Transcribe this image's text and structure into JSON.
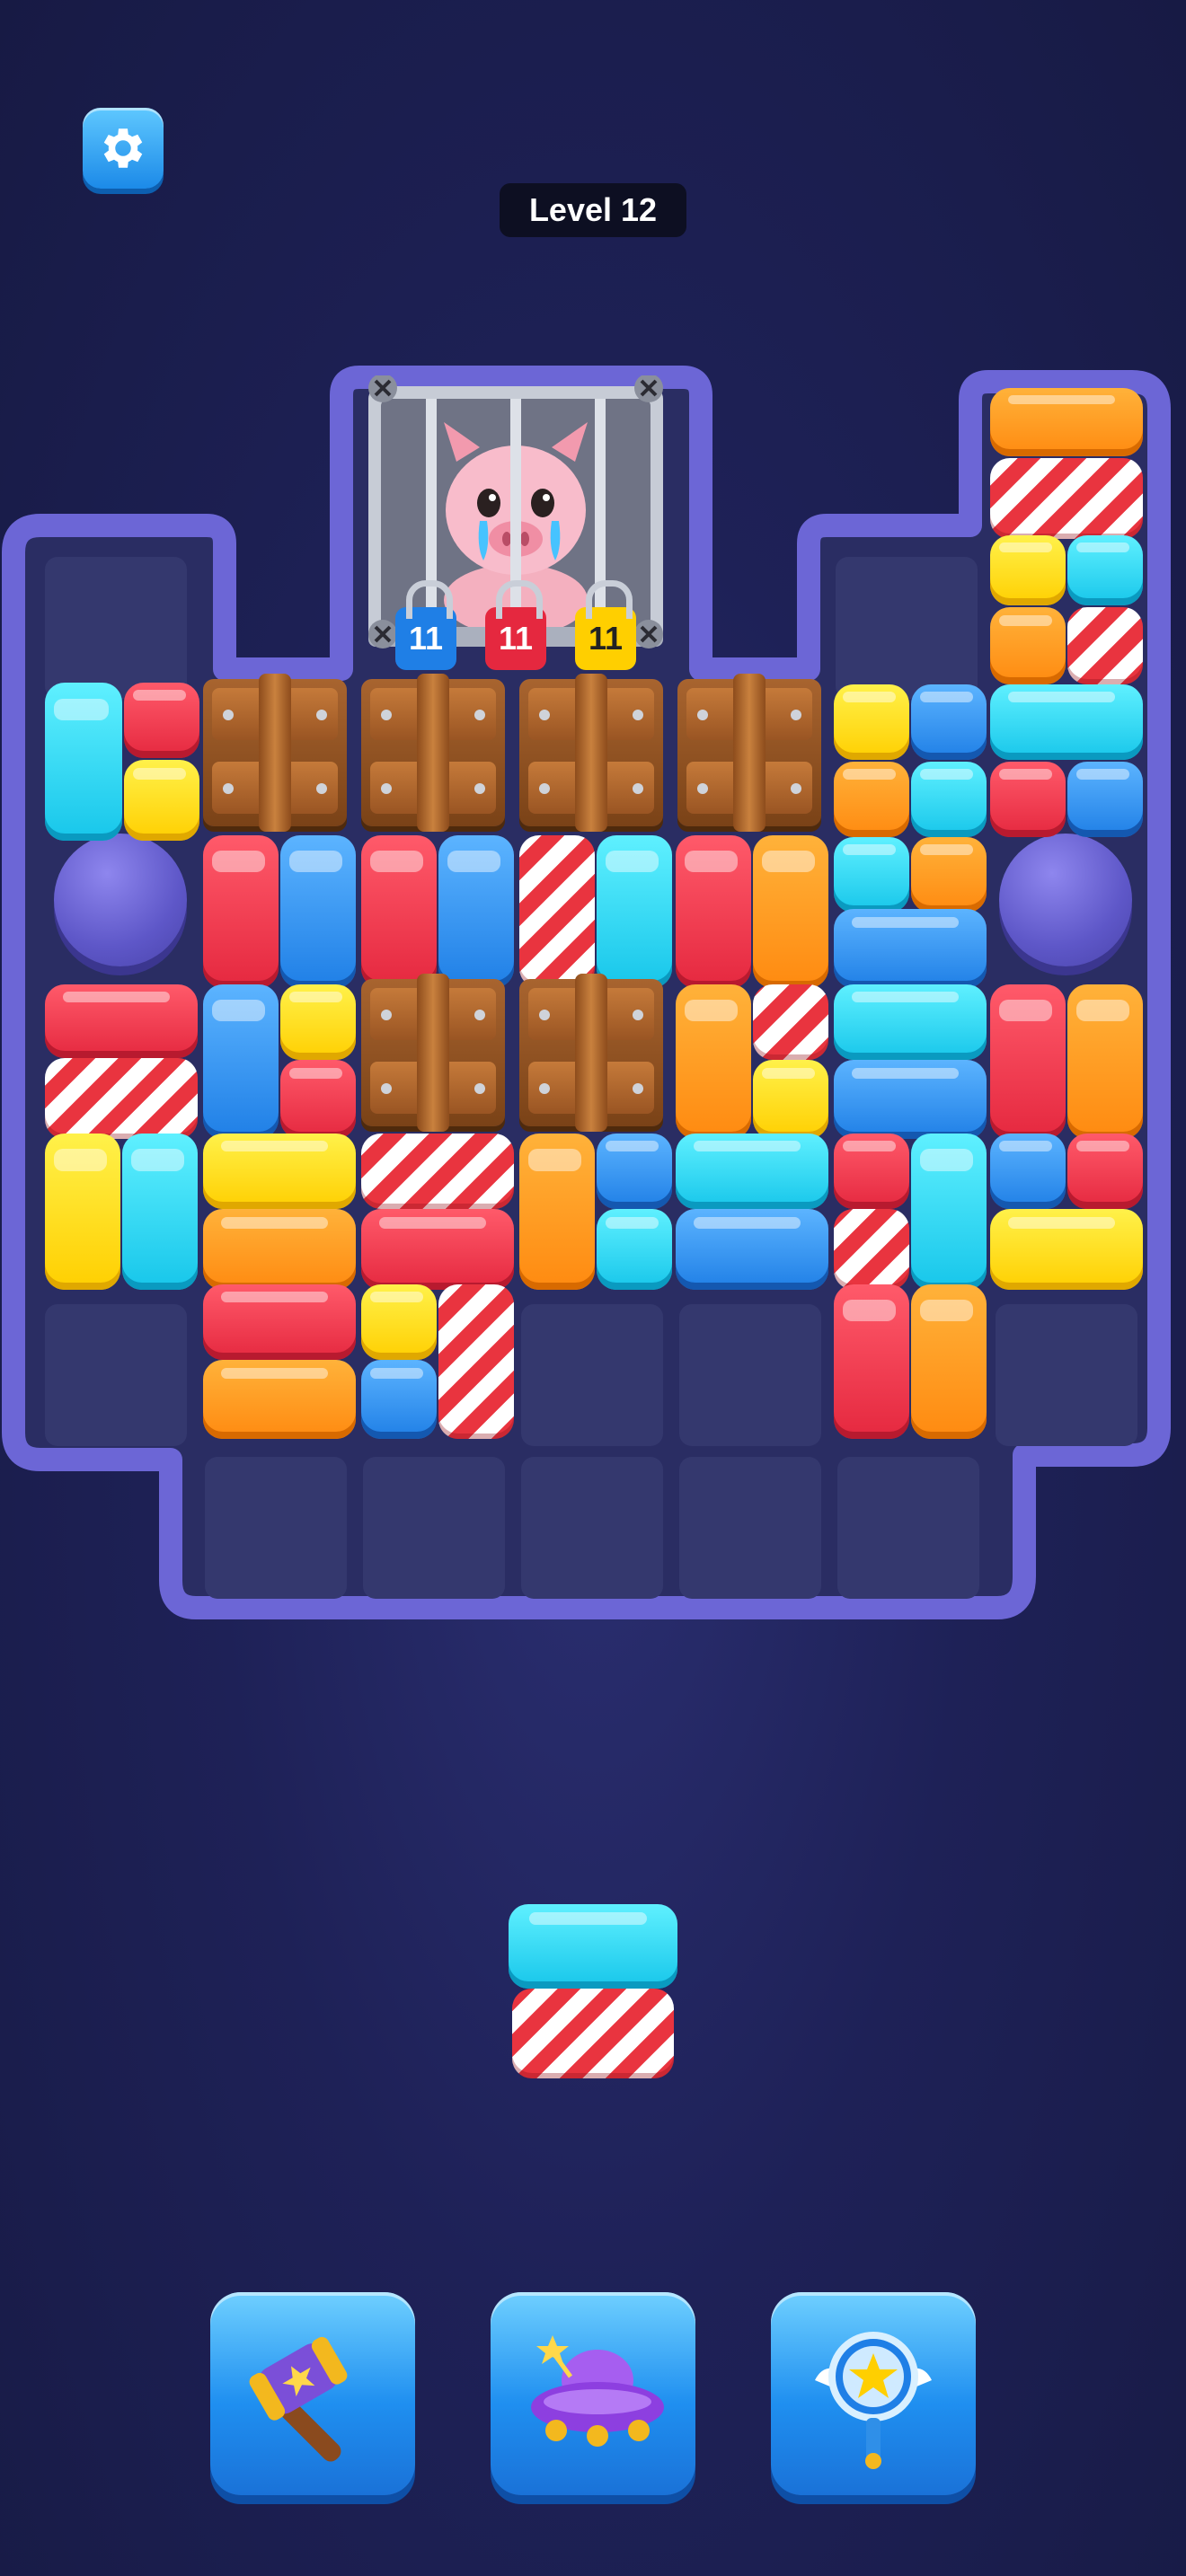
{
  "header": {
    "level_label": "Level 12"
  },
  "cage": {
    "locks": [
      {
        "value": "11",
        "color": "#1f7fe6"
      },
      {
        "value": "11",
        "color": "#e5283f"
      },
      {
        "value": "11",
        "color": "#ffcf00"
      }
    ]
  },
  "powerups": [
    {
      "name": "hammer"
    },
    {
      "name": "ufo"
    },
    {
      "name": "magic-wand"
    }
  ],
  "colors": {
    "background": "#1e2157",
    "board_frame": "#6c66d6",
    "cell": "#34386e",
    "accent_button": "#1f8ff0"
  }
}
